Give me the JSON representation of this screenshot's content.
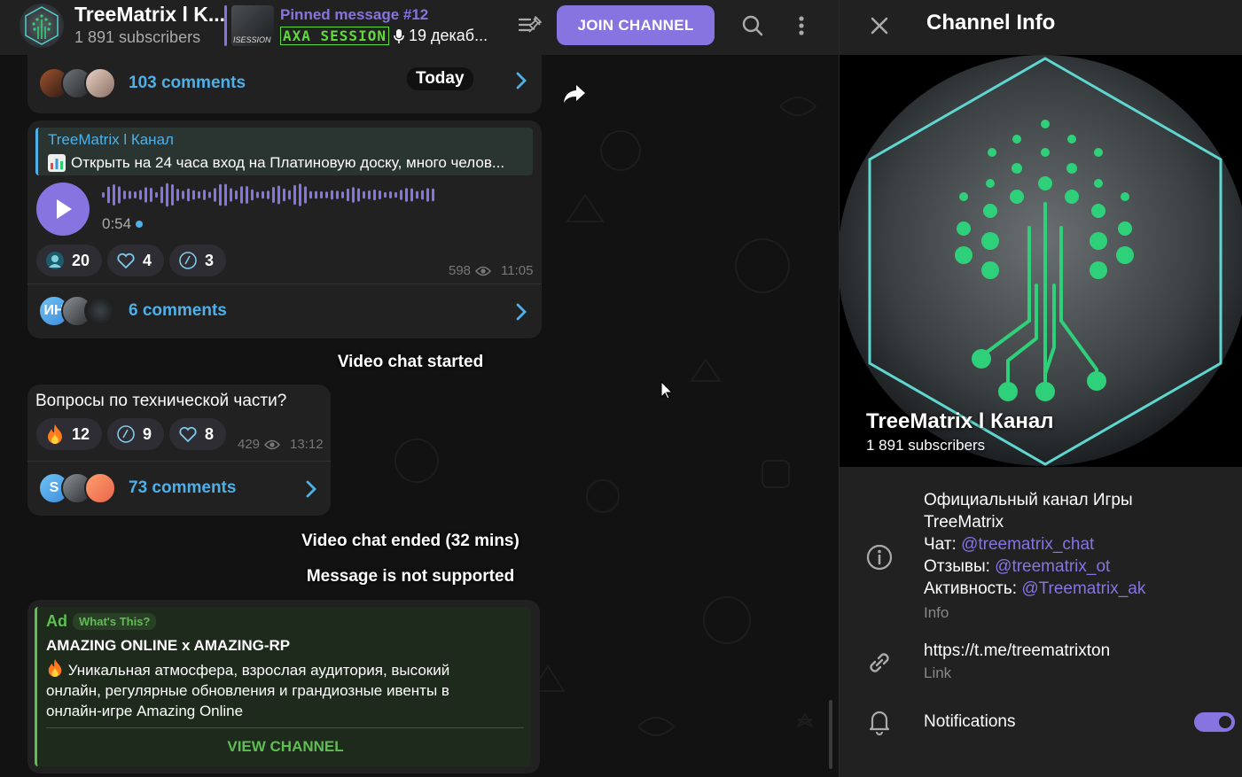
{
  "header": {
    "channel_title": "TreeMatrix l K...",
    "subscribers": "1 891 subscribers",
    "pinned_title": "Pinned message #12",
    "pinned_thumb_text": "ISESSION",
    "pinned_brand": "AXA SESSION",
    "pinned_text": "19 декаб...",
    "join_label": "JOIN CHANNEL"
  },
  "messages": {
    "m1": {
      "comments": "103 comments",
      "date_badge": "Today"
    },
    "m2": {
      "reply_author": "TreeMatrix l Канал",
      "reply_text": "Открыть на 24 часа вход на Платиновую доску, много челов...",
      "voice_duration": "0:54",
      "reactions": [
        {
          "icon": "avatar-reaction-icon",
          "count": "20"
        },
        {
          "icon": "heart-icon",
          "count": "4"
        },
        {
          "icon": "custom-emoji-icon",
          "count": "3"
        }
      ],
      "views": "598",
      "time": "11:05",
      "avatar_initials": "ИН",
      "comments": "6 comments"
    },
    "service1": "Video chat started",
    "m3": {
      "text": "Вопросы по технической части?",
      "reactions": [
        {
          "icon": "fire-icon",
          "count": "12"
        },
        {
          "icon": "custom-emoji-icon",
          "count": "9"
        },
        {
          "icon": "heart-icon",
          "count": "8"
        }
      ],
      "views": "429",
      "time": "13:12",
      "avatar_initial": "S",
      "comments": "73 comments"
    },
    "service2": "Video chat ended (32 mins)",
    "service3": "Message is not supported",
    "ad": {
      "label": "Ad",
      "whats_this": "What's This?",
      "title": "AMAZING ONLINE x AMAZING-RP",
      "body": "Уникальная атмосфера, взрослая аудитория, высокий онлайн, регулярные обновления и грандиозные ивенты в онлайн-игре Amazing Online",
      "button": "VIEW CHANNEL"
    }
  },
  "sidebar": {
    "title": "Channel Info",
    "channel_name": "TreeMatrix l Канал",
    "subscribers": "1 891 subscribers",
    "description_line1": "Официальный канал Игры TreeMatrix",
    "chat_label": "Чат: ",
    "chat_link": "@treematrix_chat",
    "reviews_label": "Отзывы: ",
    "reviews_link": "@treematrix_ot",
    "activity_label": "Активность: ",
    "activity_link": "@Treematrix_ak",
    "info_label": "Info",
    "link_value": "https://t.me/treematrixton",
    "link_label": "Link",
    "notifications_label": "Notifications",
    "notifications_on": true
  },
  "colors": {
    "accent": "#8774e1",
    "link_blue": "#4fb0e8",
    "ad_green": "#5fbe52",
    "tree_green": "#2fd07a"
  }
}
